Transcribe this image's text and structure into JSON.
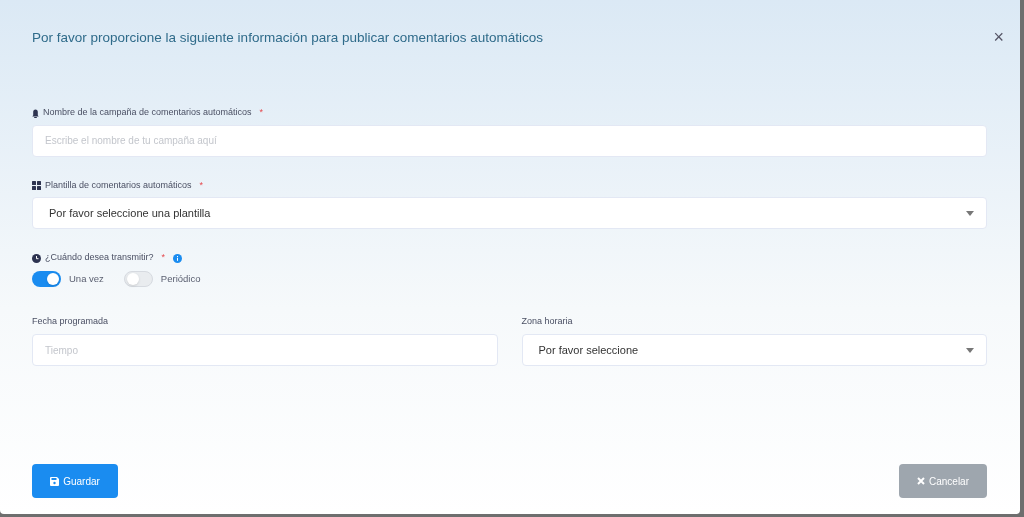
{
  "dialog": {
    "title": "Por favor proporcione la siguiente información para publicar comentarios automáticos",
    "close": "×"
  },
  "campaign_name": {
    "label": "Nombre de la campaña de comentarios automáticos",
    "required_mark": "*",
    "placeholder": "Escribe el nombre de tu campaña aquí"
  },
  "template": {
    "label": "Plantilla de comentarios automáticos",
    "required_mark": "*",
    "value": "Por favor seleccione una plantilla"
  },
  "schedule": {
    "label": "¿Cuándo desea transmitir?",
    "required_mark": "*",
    "options": [
      {
        "label": "Una vez",
        "selected": true
      },
      {
        "label": "Periódico",
        "selected": false
      }
    ]
  },
  "date": {
    "label": "Fecha programada",
    "placeholder": "Tiempo"
  },
  "timezone": {
    "label": "Zona horaria",
    "value": "Por favor seleccione"
  },
  "buttons": {
    "save": {
      "label": "Guardar",
      "disabled": false
    },
    "cancel": {
      "label": "Cancelar",
      "disabled": true
    }
  }
}
